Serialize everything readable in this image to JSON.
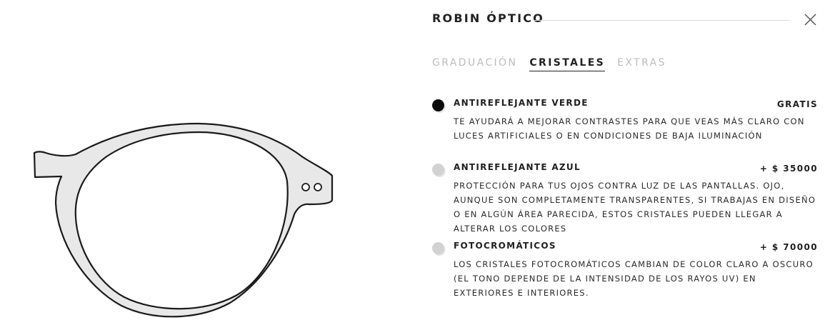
{
  "header": {
    "title": "ROBIN ÓPTICO"
  },
  "tabs": [
    {
      "label": "GRADUACIÓN",
      "active": false
    },
    {
      "label": "CRISTALES",
      "active": true
    },
    {
      "label": "EXTRAS",
      "active": false
    }
  ],
  "options": [
    {
      "name": "ANTIREFLEJANTE VERDE",
      "price": "GRATIS",
      "selected": true,
      "description": "TE AYUDARÁ A MEJORAR CONTRASTES PARA QUE VEAS MÁS CLARO CON LUCES ARTIFICIALES O EN CONDICIONES DE BAJA ILUMINACIÓN"
    },
    {
      "name": "ANTIREFLEJANTE AZUL",
      "price": "+ $ 35000",
      "selected": false,
      "description": "PROTECCIÓN PARA TUS OJOS CONTRA LUZ DE LAS PANTALLAS. OJO, AUNQUE SON COMPLETAMENTE TRANSPARENTES, SI TRABAJAS EN DISEÑO O EN ALGÚN ÁREA PARECIDA, ESTOS CRISTALES PUEDEN LLEGAR A ALTERAR LOS COLORES"
    },
    {
      "name": "FOTOCROMÁTICOS",
      "price": "+ $ 70000",
      "selected": false,
      "description": "LOS CRISTALES FOTOCROMÁTICOS CAMBIAN DE COLOR CLARO A OSCURO (EL TONO DEPENDE DE LA INTENSIDAD DE LOS RAYOS UV) EN EXTERIORES E INTERIORES."
    }
  ],
  "icons": {
    "close": "close-icon",
    "product": "glasses-frame-illustration"
  },
  "colors": {
    "text": "#1a1a1a",
    "inactive_tab": "#bdbdbd",
    "frame_fill": "#e8e8e8",
    "radio_selected": "#0a0a0a",
    "radio_unselected": "#d2d2d2"
  }
}
